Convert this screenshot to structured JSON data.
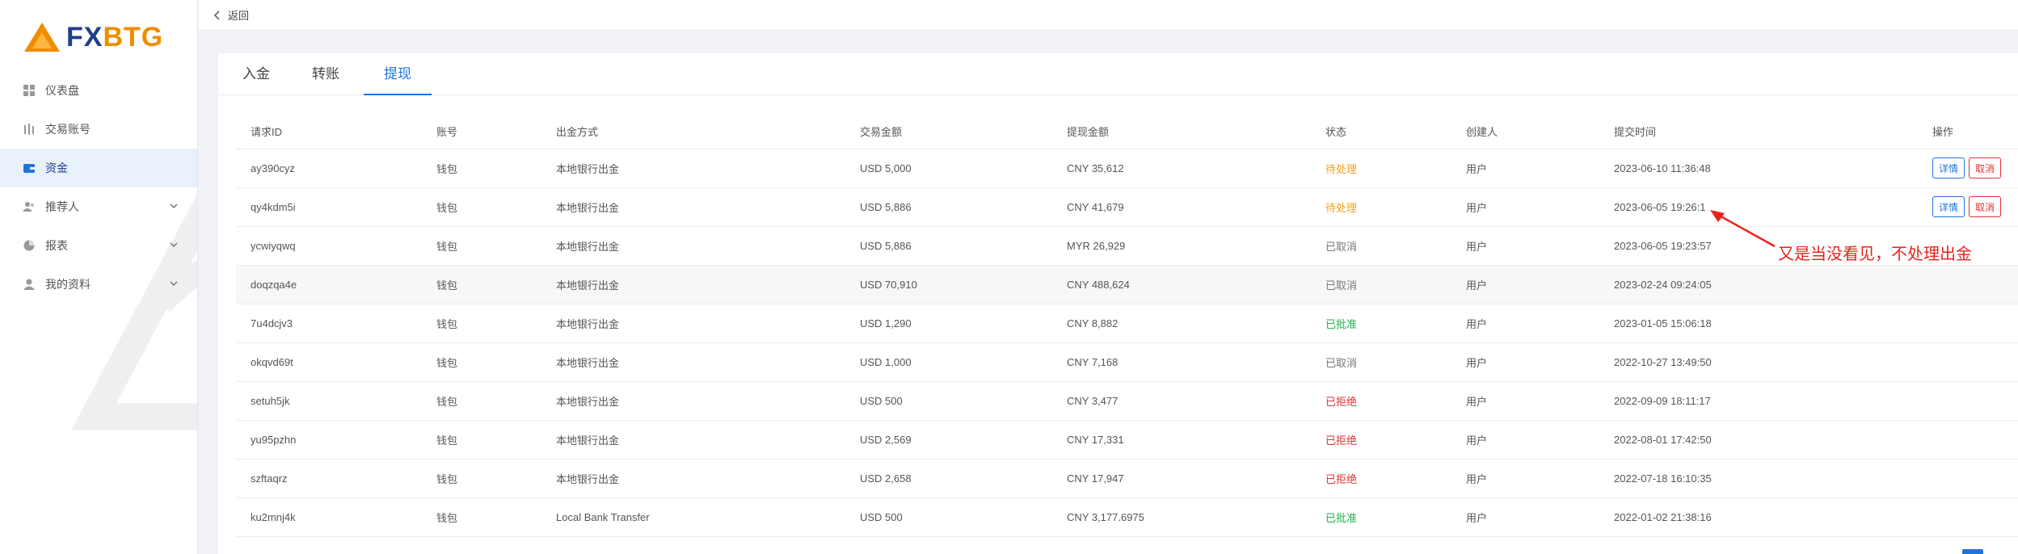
{
  "brand": {
    "logo_fx": "FX",
    "logo_btg": "BTG",
    "accent": "#1f74d6",
    "logo_blue": "#1f3f8a",
    "logo_orange": "#f08c00"
  },
  "sidebar": {
    "items": [
      {
        "label": "仪表盘",
        "icon": "dashboard-icon",
        "expandable": false,
        "active": false
      },
      {
        "label": "交易账号",
        "icon": "trading-account-icon",
        "expandable": false,
        "active": false
      },
      {
        "label": "资金",
        "icon": "wallet-icon",
        "expandable": false,
        "active": true
      },
      {
        "label": "推荐人",
        "icon": "referrer-icon",
        "expandable": true,
        "active": false
      },
      {
        "label": "报表",
        "icon": "report-icon",
        "expandable": true,
        "active": false
      },
      {
        "label": "我的资料",
        "icon": "profile-icon",
        "expandable": true,
        "active": false
      }
    ]
  },
  "topbar": {
    "back_label": "返回"
  },
  "tabs": [
    {
      "label": "入金",
      "active": false
    },
    {
      "label": "转账",
      "active": false
    },
    {
      "label": "提现",
      "active": true
    }
  ],
  "table": {
    "columns": [
      "请求ID",
      "账号",
      "出金方式",
      "交易金额",
      "提现金额",
      "状态",
      "创建人",
      "提交时间",
      "操作"
    ],
    "actions": {
      "detail": "详情",
      "cancel": "取消"
    },
    "rows": [
      {
        "id": "ay390cyz",
        "account": "钱包",
        "method": "本地银行出金",
        "amount": "USD 5,000",
        "withdraw": "CNY 35,612",
        "status": "待处理",
        "status_type": "pending",
        "creator": "用户",
        "time": "2023-06-10 11:36:48",
        "actions": true
      },
      {
        "id": "qy4kdm5i",
        "account": "钱包",
        "method": "本地银行出金",
        "amount": "USD 5,886",
        "withdraw": "CNY 41,679",
        "status": "待处理",
        "status_type": "pending",
        "creator": "用户",
        "time": "2023-06-05 19:26:1",
        "actions": true
      },
      {
        "id": "ycwiyqwq",
        "account": "钱包",
        "method": "本地银行出金",
        "amount": "USD 5,886",
        "withdraw": "MYR 26,929",
        "status": "已取消",
        "status_type": "cancel",
        "creator": "用户",
        "time": "2023-06-05 19:23:57",
        "actions": false
      },
      {
        "id": "doqzqa4e",
        "account": "钱包",
        "method": "本地银行出金",
        "amount": "USD 70,910",
        "withdraw": "CNY 488,624",
        "status": "已取消",
        "status_type": "cancel",
        "creator": "用户",
        "time": "2023-02-24 09:24:05",
        "actions": false
      },
      {
        "id": "7u4dcjv3",
        "account": "钱包",
        "method": "本地银行出金",
        "amount": "USD 1,290",
        "withdraw": "CNY 8,882",
        "status": "已批准",
        "status_type": "approved",
        "creator": "用户",
        "time": "2023-01-05 15:06:18",
        "actions": false
      },
      {
        "id": "okqvd69t",
        "account": "钱包",
        "method": "本地银行出金",
        "amount": "USD 1,000",
        "withdraw": "CNY 7,168",
        "status": "已取消",
        "status_type": "cancel",
        "creator": "用户",
        "time": "2022-10-27 13:49:50",
        "actions": false
      },
      {
        "id": "setuh5jk",
        "account": "钱包",
        "method": "本地银行出金",
        "amount": "USD 500",
        "withdraw": "CNY 3,477",
        "status": "已拒绝",
        "status_type": "rejected",
        "creator": "用户",
        "time": "2022-09-09 18:11:17",
        "actions": false
      },
      {
        "id": "yu95pzhn",
        "account": "钱包",
        "method": "本地银行出金",
        "amount": "USD 2,569",
        "withdraw": "CNY 17,331",
        "status": "已拒绝",
        "status_type": "rejected",
        "creator": "用户",
        "time": "2022-08-01 17:42:50",
        "actions": false
      },
      {
        "id": "szftaqrz",
        "account": "钱包",
        "method": "本地银行出金",
        "amount": "USD 2,658",
        "withdraw": "CNY 17,947",
        "status": "已拒绝",
        "status_type": "rejected",
        "creator": "用户",
        "time": "2022-07-18 16:10:35",
        "actions": false
      },
      {
        "id": "ku2mnj4k",
        "account": "钱包",
        "method": "Local Bank Transfer",
        "amount": "USD 500",
        "withdraw": "CNY 3,177.6975",
        "status": "已批准",
        "status_type": "approved",
        "creator": "用户",
        "time": "2022-01-02 21:38:16",
        "actions": false
      }
    ]
  },
  "annotation": {
    "text": "又是当没看见，不处理出金",
    "color": "#e8231e"
  }
}
